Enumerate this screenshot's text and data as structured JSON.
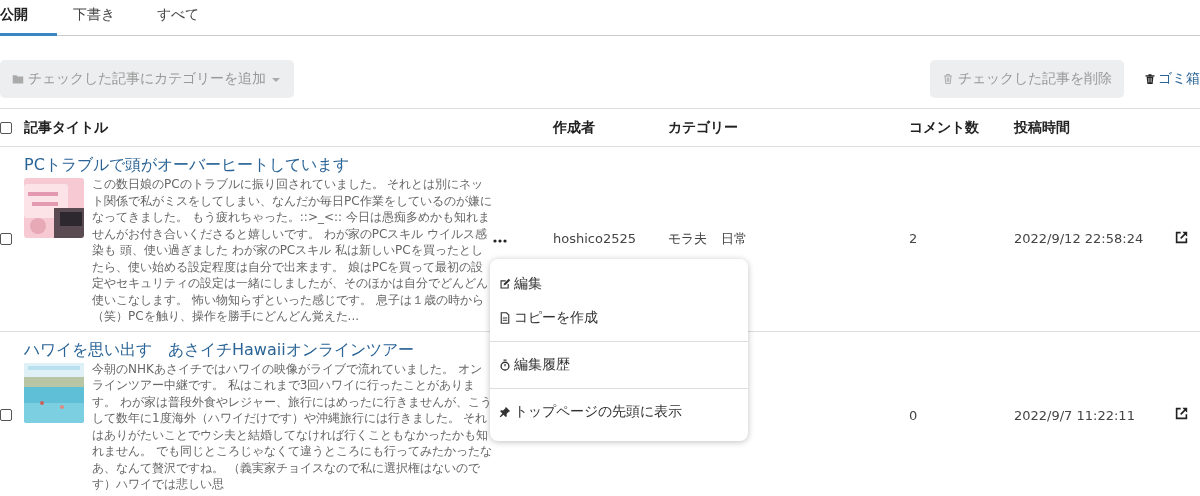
{
  "tabs": [
    {
      "label": "公開",
      "selected": true
    },
    {
      "label": "下書き",
      "selected": false
    },
    {
      "label": "すべて",
      "selected": false
    }
  ],
  "toolbar": {
    "add_category_button": {
      "label": "チェックした記事にカテゴリーを追加",
      "disabled": true
    },
    "delete_button": {
      "label": "チェックした記事を削除",
      "disabled": true
    },
    "trash_link": {
      "label": "ゴミ箱"
    }
  },
  "table": {
    "select_all_checked": false,
    "columns": [
      "記事タイトル",
      "作成者",
      "カテゴリー",
      "コメント数",
      "投稿時間"
    ],
    "rows": [
      {
        "checked": false,
        "title": "PCトラブルで頭がオーバーヒートしています",
        "excerpt": "この数日娘のPCのトラブルに振り回されていました。 それとは別にネット関係で私がミスをしてしまい、なんだか毎日PC作業をしているのが嫌になってきました。 もう疲れちゃった。::>_<:: 今日は愚痴多めかも知れませんがお付き合いくださると嬉しいです。 わが家のPCスキル ウイルス感染も 頭、使い過ぎました わが家のPCスキル 私は新しいPCを買ったとしたら、使い始める設定程度は自分で出来ます。 娘はPCを買って最初の設定やセキュリティの設定は一緒にしましたが、そのほかは自分でどんどん使いこなします。 怖い物知らずといった感じです。 息子は１歳の時から（笑）PCを触り、操作を勝手にどんどん覚えた...",
        "author": "hoshico2525",
        "categories": [
          "モラ夫",
          "日常"
        ],
        "comments": "2",
        "posted": "2022/9/12 22:58:24",
        "menu_open": true
      },
      {
        "checked": false,
        "title": "ハワイを思い出す　あさイチHawaiiオンラインツアー",
        "excerpt": "今朝のNHKあさイチではハワイの映像がライブで流れていました。 オンラインツアー中継です。 私はこれまで3回ハワイに行ったことがあります。 わが家は普段外食やレジャー、旅行にはめったに行きませんが、こうして数年に1度海外（ハワイだけです）や沖縄旅行には行きました。 それはありがたいことでウシ夫と結婚してなければ行くこともなかったかも知れません。 でも同じところじゃなくて違うところにも行ってみたかったなあ、なんて贅沢ですね。 （義実家チョイスなので私に選択権はないのです）ハワイでは悲しい思",
        "comments": "0",
        "posted": "2022/9/7 11:22:11",
        "menu_open": false
      }
    ]
  },
  "context_menu": {
    "groups": [
      [
        {
          "kind": "edit",
          "label": "編集"
        },
        {
          "kind": "copy",
          "label": "コピーを作成"
        }
      ],
      [
        {
          "kind": "history",
          "label": "編集履歴"
        }
      ],
      [
        {
          "kind": "pin",
          "label": "トップページの先頭に表示"
        }
      ]
    ]
  }
}
